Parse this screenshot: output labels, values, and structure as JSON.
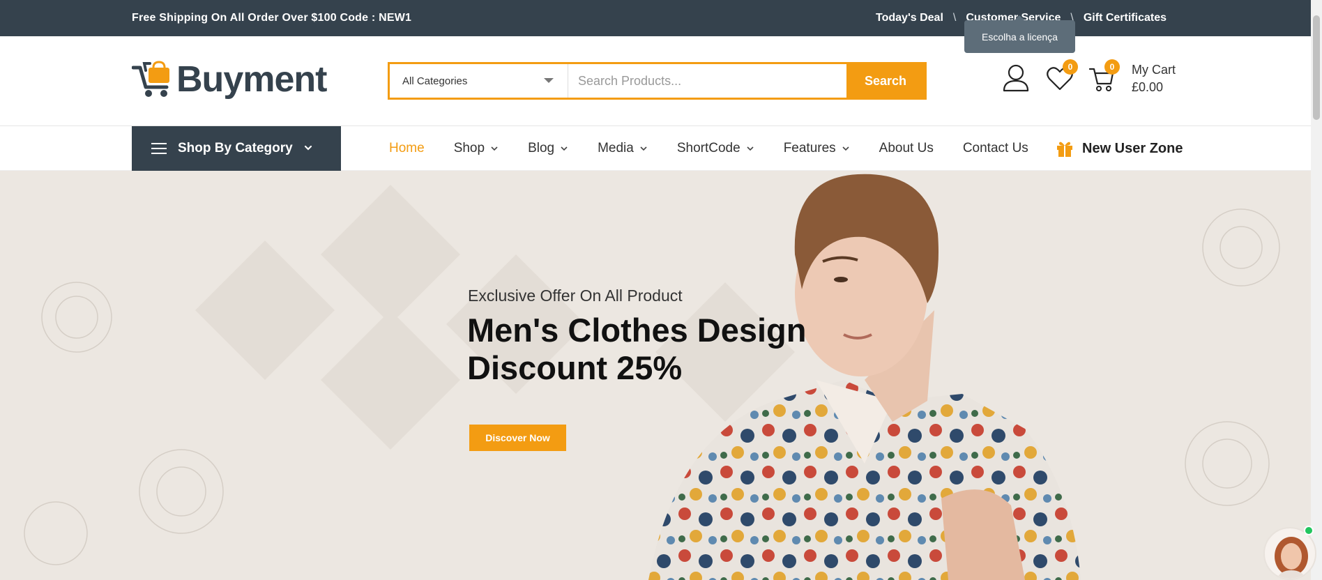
{
  "topbar": {
    "promo": "Free Shipping On All Order Over $100 Code : NEW1",
    "links": [
      "Today's Deal",
      "Customer Service",
      "Gift Certificates"
    ],
    "separator": "\\",
    "tooltip": "Escolha a licença"
  },
  "header": {
    "logo_text": "Buyment",
    "search": {
      "category": "All Categories",
      "placeholder": "Search Products...",
      "button": "Search"
    },
    "wishlist_count": "0",
    "cart_count": "0",
    "cart_label": "My Cart",
    "cart_total": "£0.00"
  },
  "nav": {
    "shop_by_category": "Shop By Category",
    "items": [
      {
        "label": "Home",
        "dropdown": false
      },
      {
        "label": "Shop",
        "dropdown": true
      },
      {
        "label": "Blog",
        "dropdown": true
      },
      {
        "label": "Media",
        "dropdown": true
      },
      {
        "label": "ShortCode",
        "dropdown": true
      },
      {
        "label": "Features",
        "dropdown": true
      },
      {
        "label": "About Us",
        "dropdown": false
      },
      {
        "label": "Contact Us",
        "dropdown": false
      }
    ],
    "new_user_zone": "New User Zone"
  },
  "hero": {
    "subtitle": "Exclusive Offer On All Product",
    "title_line1": "Men's Clothes Design",
    "title_line2": "Discount 25%",
    "cta": "Discover Now"
  },
  "colors": {
    "accent": "#f39c12",
    "dark": "#35424d",
    "hero_bg": "#ece7e1"
  }
}
